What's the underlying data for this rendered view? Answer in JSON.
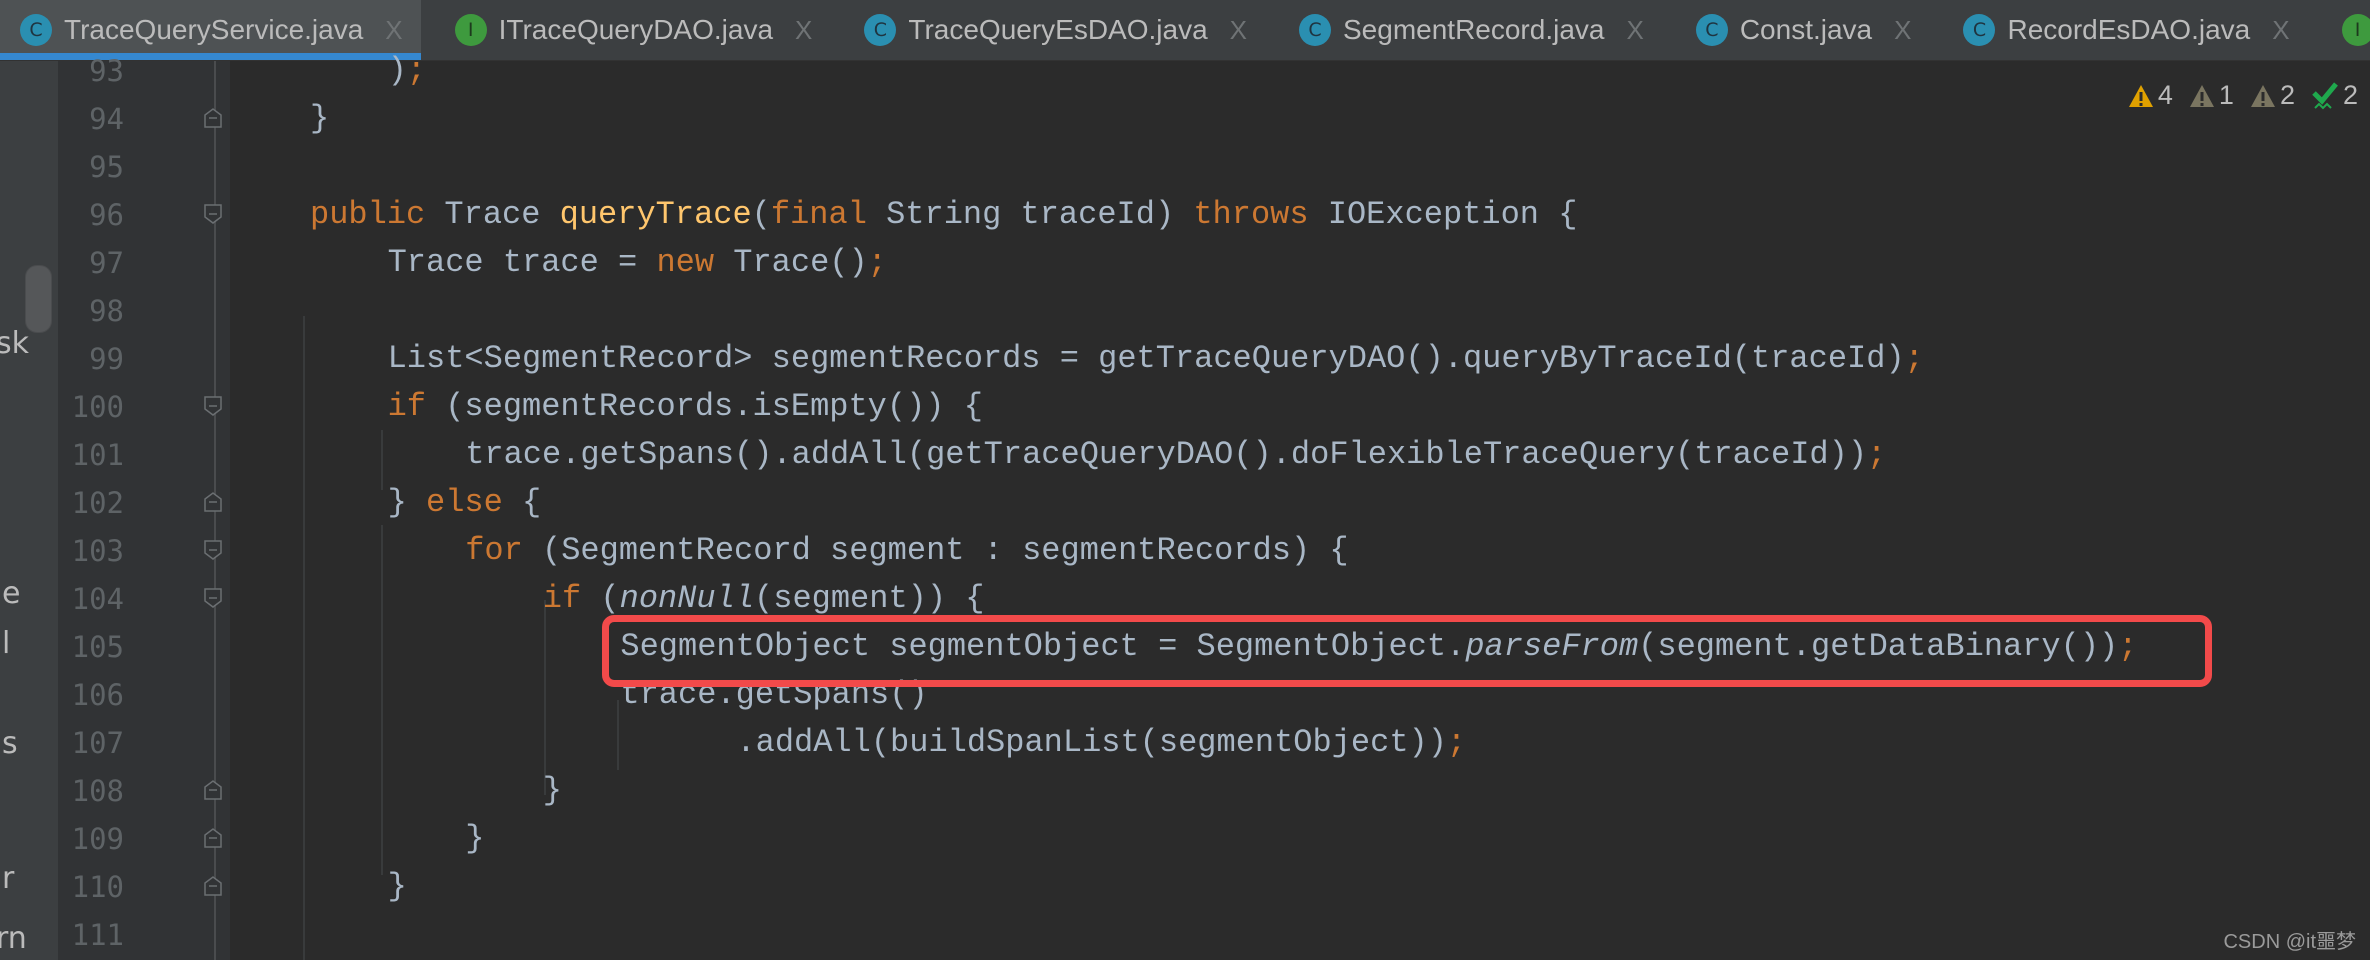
{
  "tabs": [
    {
      "label": "TraceQueryService.java",
      "kind": "C",
      "active": true
    },
    {
      "label": "ITraceQueryDAO.java",
      "kind": "I",
      "active": false
    },
    {
      "label": "TraceQueryEsDAO.java",
      "kind": "C",
      "active": false
    },
    {
      "label": "SegmentRecord.java",
      "kind": "C",
      "active": false
    },
    {
      "label": "Const.java",
      "kind": "C",
      "active": false
    },
    {
      "label": "RecordEsDAO.java",
      "kind": "C",
      "active": false
    },
    {
      "label": "",
      "kind": "I",
      "active": false
    }
  ],
  "tab_close_glyph": "X",
  "left_panel_fragments": [
    "sk",
    "e",
    "l",
    "s",
    "r",
    "rn"
  ],
  "indicators": {
    "warnings": "4",
    "weak_warnings": "1",
    "typos": "2",
    "ok": "2"
  },
  "colors": {
    "keyword": "#cc7832",
    "method": "#ffc66d",
    "text": "#a9b7c6",
    "highlight_box": "#f24a4a",
    "tab_underline": "#3588d0"
  },
  "lines": [
    {
      "n": "93",
      "indent": 1,
      "tokens": [
        {
          "t": ")"
        },
        {
          "t": ";",
          "c": "semi"
        }
      ]
    },
    {
      "n": "94",
      "indent": 0,
      "tokens": [
        {
          "t": "}"
        }
      ]
    },
    {
      "n": "95",
      "indent": 0,
      "tokens": []
    },
    {
      "n": "96",
      "indent": 0,
      "tokens": [
        {
          "t": "public",
          "c": "kw"
        },
        {
          "t": " Trace "
        },
        {
          "t": "queryTrace",
          "c": "fn"
        },
        {
          "t": "("
        },
        {
          "t": "final",
          "c": "kw"
        },
        {
          "t": " String traceId) "
        },
        {
          "t": "throws",
          "c": "kw"
        },
        {
          "t": " IOException {"
        }
      ]
    },
    {
      "n": "97",
      "indent": 1,
      "tokens": [
        {
          "t": "Trace trace = "
        },
        {
          "t": "new",
          "c": "kw"
        },
        {
          "t": " Trace()"
        },
        {
          "t": ";",
          "c": "semi"
        }
      ]
    },
    {
      "n": "98",
      "indent": 0,
      "tokens": []
    },
    {
      "n": "99",
      "indent": 1,
      "tokens": [
        {
          "t": "List<SegmentRecord> segmentRecords = getTraceQueryDAO().queryByTraceId(traceId)"
        },
        {
          "t": ";",
          "c": "semi"
        }
      ]
    },
    {
      "n": "100",
      "indent": 1,
      "tokens": [
        {
          "t": "if",
          "c": "kw"
        },
        {
          "t": " (segmentRecords.isEmpty()) {"
        }
      ]
    },
    {
      "n": "101",
      "indent": 2,
      "tokens": [
        {
          "t": "trace.getSpans().addAll(getTraceQueryDAO().doFlexibleTraceQuery(traceId))"
        },
        {
          "t": ";",
          "c": "semi"
        }
      ]
    },
    {
      "n": "102",
      "indent": 1,
      "tokens": [
        {
          "t": "} "
        },
        {
          "t": "else",
          "c": "kw"
        },
        {
          "t": " {"
        }
      ]
    },
    {
      "n": "103",
      "indent": 2,
      "tokens": [
        {
          "t": "for",
          "c": "kw"
        },
        {
          "t": " (SegmentRecord segment : segmentRecords) {"
        }
      ]
    },
    {
      "n": "104",
      "indent": 3,
      "tokens": [
        {
          "t": "if",
          "c": "kw"
        },
        {
          "t": " ("
        },
        {
          "t": "nonNull",
          "c": "it"
        },
        {
          "t": "(segment)) {"
        }
      ]
    },
    {
      "n": "105",
      "indent": 4,
      "tokens": [
        {
          "t": "SegmentObject segmentObject = SegmentObject."
        },
        {
          "t": "parseFrom",
          "c": "it"
        },
        {
          "t": "(segment.getDataBinary())"
        },
        {
          "t": ";",
          "c": "semi"
        }
      ]
    },
    {
      "n": "106",
      "indent": 4,
      "tokens": [
        {
          "t": "trace.getSpans()"
        }
      ]
    },
    {
      "n": "107",
      "indent": 5,
      "tokens": [
        {
          "t": "  .addAll(buildSpanList(segmentObject))"
        },
        {
          "t": ";",
          "c": "semi"
        }
      ]
    },
    {
      "n": "108",
      "indent": 3,
      "tokens": [
        {
          "t": "}"
        }
      ]
    },
    {
      "n": "109",
      "indent": 2,
      "tokens": [
        {
          "t": "}"
        }
      ]
    },
    {
      "n": "110",
      "indent": 1,
      "tokens": [
        {
          "t": "}"
        }
      ]
    },
    {
      "n": "111",
      "indent": 0,
      "tokens": []
    }
  ],
  "folds": {
    "94": "end",
    "96": "start",
    "100": "start",
    "102": "end",
    "103": "start",
    "104": "start",
    "108": "end",
    "109": "end",
    "110": "end"
  },
  "highlighted_line": "105",
  "watermark": "CSDN @it噩梦"
}
